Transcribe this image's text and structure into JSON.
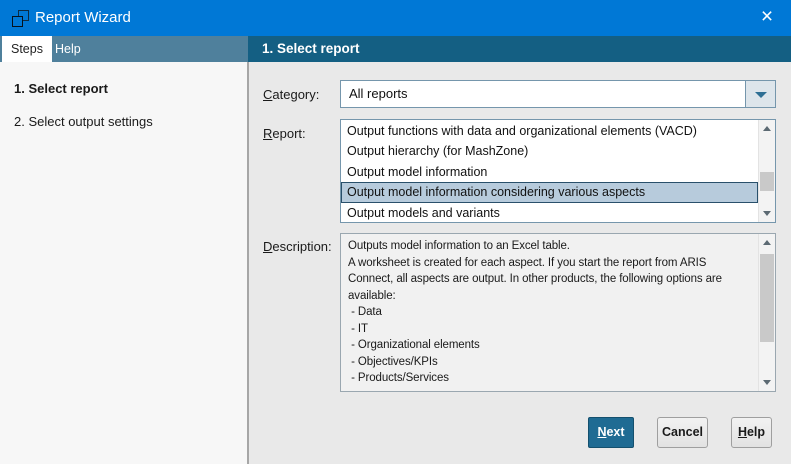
{
  "window": {
    "title": "Report Wizard",
    "close_glyph": "×"
  },
  "tabs": [
    {
      "label": "Steps",
      "active": true
    },
    {
      "label": "Help",
      "active": false
    }
  ],
  "header": {
    "title": "1. Select report"
  },
  "steps": [
    {
      "label": "1. Select report",
      "current": true
    },
    {
      "label": "2. Select output settings",
      "current": false
    }
  ],
  "form": {
    "category": {
      "label_mnemonic": "C",
      "label_rest": "ategory:",
      "value": "All reports"
    },
    "report": {
      "label_mnemonic": "R",
      "label_rest": "eport:",
      "selected_index": 3,
      "items": [
        "Output functions with data and organizational elements (VACD)",
        "Output hierarchy (for MashZone)",
        "Output model information",
        "Output model information considering various aspects",
        "Output models and variants"
      ]
    },
    "description": {
      "label_mnemonic": "D",
      "label_rest": "escription:",
      "text": "Outputs model information to an Excel table.\nA worksheet is created for each aspect. If you start the report from ARIS Connect, all aspects are output. In other products, the following options are available:\n - Data\n - IT\n - Organizational elements\n - Objectives/KPIs\n - Products/Services"
    }
  },
  "buttons": {
    "next_mnemonic": "N",
    "next_rest": "ext",
    "cancel": "Cancel",
    "help_mnemonic": "H",
    "help_rest": "elp"
  },
  "colors": {
    "titlebar": "#0078d6",
    "tab_strip": "#4f809c",
    "step_header": "#145f83",
    "next_button": "#1f6b93",
    "selection_bg": "#b7cbdc",
    "selection_border": "#29506b"
  }
}
